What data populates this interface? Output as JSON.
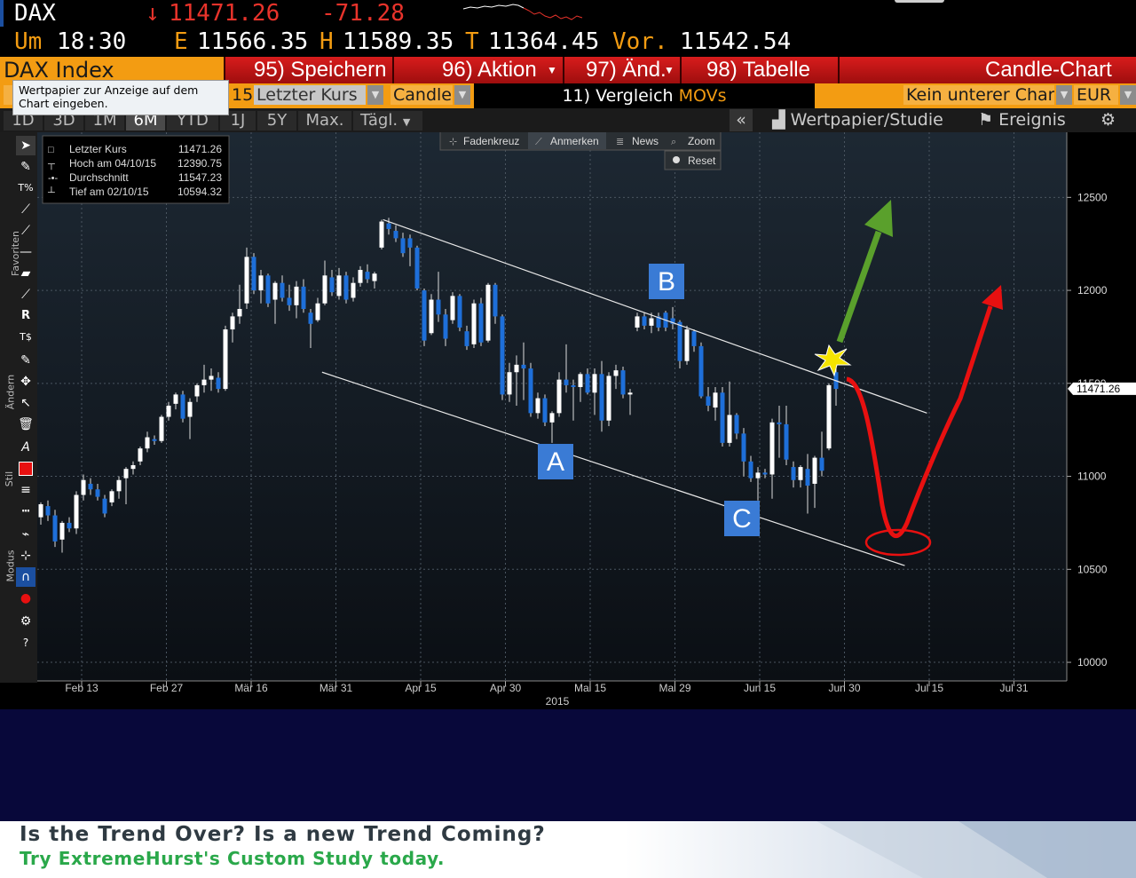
{
  "quote": {
    "ticker": "DAX",
    "arrow": "↓",
    "last": "11471.26",
    "change": "-71.28",
    "time_label": "Um",
    "time": "18:30",
    "open_label": "E",
    "open": "11566.35",
    "high_label": "H",
    "high": "11589.35",
    "low_label": "T",
    "low": "11364.45",
    "prev_label": "Vor.",
    "prev": "11542.54"
  },
  "toolbar": {
    "index_name": "DAX Index",
    "save": "95) Speichern",
    "action": "96) Aktion",
    "change": "97) Änd.",
    "table": "98) Tabelle",
    "chart_type_title": "Candle-Chart"
  },
  "tooltip": {
    "text": "Wertpapier zur Anzeige auf dem Chart eingeben."
  },
  "options": {
    "date_field": "15",
    "price_field": "Letzter Kurs",
    "style_field": "Candle",
    "compare": "11) Vergleich",
    "compare_movs": "MOVs",
    "lower_chart": "Kein unterer Chart",
    "currency": "EUR"
  },
  "periods": {
    "items": [
      "1D",
      "3D",
      "1M",
      "6M",
      "YTD",
      "1J",
      "5Y",
      "Max."
    ],
    "active": "6M",
    "interval": "Tägl."
  },
  "right_tools": {
    "collapse": "«",
    "security_study": "Wertpapier/Studie",
    "events": "Ereignis"
  },
  "chart_tools": {
    "crosshair": "Fadenkreuz",
    "annotate": "Anmerken",
    "news": "News",
    "zoom": "Zoom",
    "reset": "Reset"
  },
  "palette_labels": {
    "favorites": "Favoriten",
    "change": "Ändern",
    "style": "Stil",
    "mode": "Modus"
  },
  "legend": [
    {
      "label": "Letzter Kurs",
      "value": "11471.26"
    },
    {
      "label": "Hoch am 04/10/15",
      "value": "12390.75"
    },
    {
      "label": "Durchschnitt",
      "value": "11547.23"
    },
    {
      "label": "Tief am 02/10/15",
      "value": "10594.32"
    }
  ],
  "annotations": {
    "A": "A",
    "B": "B",
    "C": "C"
  },
  "ad": {
    "line1": "Is the Trend Over? Is a new Trend Coming?",
    "line2": "Try ExtremeHurst's Custom Study today."
  },
  "colors": {
    "up_candle": "#ffffff",
    "down_candle": "#1e6fd9",
    "arrow_green": "#5aa02c",
    "arrow_red": "#e81010",
    "label_box": "#3a7bd5",
    "toolbar_red": "#c21414",
    "accent_orange": "#f39c12"
  },
  "chart_data": {
    "type": "candlestick",
    "title": "",
    "xlabel": "2015",
    "ylabel": "",
    "ylim": [
      9900,
      12850
    ],
    "y_ticks": [
      10000,
      10500,
      11000,
      11500,
      12000,
      12500
    ],
    "x_ticks": [
      "Feb 13",
      "Feb 27",
      "Mär 16",
      "Mär 31",
      "Apr 15",
      "Apr 30",
      "Mai 15",
      "Mai 29",
      "Jun 15",
      "Jun 30",
      "Jul 15",
      "Jul 31"
    ],
    "last_price_label": "11471.26",
    "last_value": 11471.26,
    "grid": true,
    "candles": [
      {
        "o": 10780,
        "h": 10860,
        "l": 10740,
        "c": 10850
      },
      {
        "o": 10840,
        "h": 10870,
        "l": 10760,
        "c": 10790
      },
      {
        "o": 10790,
        "h": 10820,
        "l": 10620,
        "c": 10650
      },
      {
        "o": 10660,
        "h": 10760,
        "l": 10590,
        "c": 10750
      },
      {
        "o": 10750,
        "h": 10780,
        "l": 10700,
        "c": 10720
      },
      {
        "o": 10720,
        "h": 10920,
        "l": 10690,
        "c": 10900
      },
      {
        "o": 10900,
        "h": 11010,
        "l": 10870,
        "c": 10980
      },
      {
        "o": 10960,
        "h": 10990,
        "l": 10900,
        "c": 10930
      },
      {
        "o": 10930,
        "h": 10960,
        "l": 10870,
        "c": 10890
      },
      {
        "o": 10880,
        "h": 10900,
        "l": 10780,
        "c": 10800
      },
      {
        "o": 10860,
        "h": 10930,
        "l": 10840,
        "c": 10920
      },
      {
        "o": 10920,
        "h": 11000,
        "l": 10880,
        "c": 10980
      },
      {
        "o": 10990,
        "h": 11050,
        "l": 10850,
        "c": 11040
      },
      {
        "o": 11040,
        "h": 11080,
        "l": 11010,
        "c": 11060
      },
      {
        "o": 11080,
        "h": 11160,
        "l": 11060,
        "c": 11150
      },
      {
        "o": 11150,
        "h": 11240,
        "l": 11130,
        "c": 11210
      },
      {
        "o": 11200,
        "h": 11220,
        "l": 11170,
        "c": 11190
      },
      {
        "o": 11190,
        "h": 11330,
        "l": 11180,
        "c": 11320
      },
      {
        "o": 11320,
        "h": 11400,
        "l": 11300,
        "c": 11380
      },
      {
        "o": 11390,
        "h": 11450,
        "l": 11360,
        "c": 11440
      },
      {
        "o": 11440,
        "h": 11460,
        "l": 11290,
        "c": 11310
      },
      {
        "o": 11320,
        "h": 11420,
        "l": 11200,
        "c": 11400
      },
      {
        "o": 11430,
        "h": 11500,
        "l": 11400,
        "c": 11490
      },
      {
        "o": 11490,
        "h": 11600,
        "l": 11450,
        "c": 11520
      },
      {
        "o": 11520,
        "h": 11580,
        "l": 11460,
        "c": 11540
      },
      {
        "o": 11530,
        "h": 11560,
        "l": 11450,
        "c": 11470
      },
      {
        "o": 11470,
        "h": 11810,
        "l": 11460,
        "c": 11790
      },
      {
        "o": 11790,
        "h": 11880,
        "l": 11720,
        "c": 11860
      },
      {
        "o": 11860,
        "h": 12030,
        "l": 11820,
        "c": 11900
      },
      {
        "o": 11930,
        "h": 12230,
        "l": 11900,
        "c": 12180
      },
      {
        "o": 12180,
        "h": 12200,
        "l": 11980,
        "c": 12000
      },
      {
        "o": 12000,
        "h": 12110,
        "l": 11930,
        "c": 12080
      },
      {
        "o": 12080,
        "h": 12090,
        "l": 11910,
        "c": 11930
      },
      {
        "o": 11950,
        "h": 12050,
        "l": 11820,
        "c": 12040
      },
      {
        "o": 12040,
        "h": 12080,
        "l": 11940,
        "c": 11960
      },
      {
        "o": 11960,
        "h": 12030,
        "l": 11890,
        "c": 11920
      },
      {
        "o": 11920,
        "h": 12050,
        "l": 11850,
        "c": 12020
      },
      {
        "o": 12020,
        "h": 12060,
        "l": 11880,
        "c": 11900
      },
      {
        "o": 11880,
        "h": 11900,
        "l": 11690,
        "c": 11820
      },
      {
        "o": 11840,
        "h": 11960,
        "l": 11830,
        "c": 11930
      },
      {
        "o": 11930,
        "h": 12160,
        "l": 11920,
        "c": 12080
      },
      {
        "o": 12070,
        "h": 12110,
        "l": 11970,
        "c": 11990
      },
      {
        "o": 11970,
        "h": 12120,
        "l": 11950,
        "c": 12080
      },
      {
        "o": 12080,
        "h": 12100,
        "l": 11930,
        "c": 11950
      },
      {
        "o": 11960,
        "h": 12070,
        "l": 11940,
        "c": 12040
      },
      {
        "o": 12040,
        "h": 12130,
        "l": 12020,
        "c": 12110
      },
      {
        "o": 12100,
        "h": 12140,
        "l": 12040,
        "c": 12060
      },
      {
        "o": 12050,
        "h": 12100,
        "l": 12010,
        "c": 12090
      },
      {
        "o": 12230,
        "h": 12380,
        "l": 12220,
        "c": 12370
      },
      {
        "o": 12360,
        "h": 12390,
        "l": 12300,
        "c": 12330
      },
      {
        "o": 12320,
        "h": 12350,
        "l": 12260,
        "c": 12280
      },
      {
        "o": 12280,
        "h": 12310,
        "l": 12180,
        "c": 12200
      },
      {
        "o": 12280,
        "h": 12300,
        "l": 12130,
        "c": 12230
      },
      {
        "o": 12230,
        "h": 12240,
        "l": 12000,
        "c": 12010
      },
      {
        "o": 12000,
        "h": 12010,
        "l": 11700,
        "c": 11730
      },
      {
        "o": 11770,
        "h": 11980,
        "l": 11760,
        "c": 11950
      },
      {
        "o": 11950,
        "h": 12100,
        "l": 11830,
        "c": 11870
      },
      {
        "o": 11870,
        "h": 11900,
        "l": 11700,
        "c": 11740
      },
      {
        "o": 11840,
        "h": 11990,
        "l": 11820,
        "c": 11970
      },
      {
        "o": 11970,
        "h": 11980,
        "l": 11780,
        "c": 11800
      },
      {
        "o": 11780,
        "h": 11810,
        "l": 11680,
        "c": 11700
      },
      {
        "o": 11710,
        "h": 11950,
        "l": 11690,
        "c": 11930
      },
      {
        "o": 11930,
        "h": 11960,
        "l": 11700,
        "c": 11720
      },
      {
        "o": 11730,
        "h": 12040,
        "l": 11720,
        "c": 12030
      },
      {
        "o": 12030,
        "h": 12040,
        "l": 11820,
        "c": 11860
      },
      {
        "o": 11860,
        "h": 11870,
        "l": 11410,
        "c": 11440
      },
      {
        "o": 11440,
        "h": 11610,
        "l": 11400,
        "c": 11560
      },
      {
        "o": 11560,
        "h": 11650,
        "l": 11380,
        "c": 11600
      },
      {
        "o": 11600,
        "h": 11720,
        "l": 11410,
        "c": 11580
      },
      {
        "o": 11580,
        "h": 11610,
        "l": 11320,
        "c": 11340
      },
      {
        "o": 11340,
        "h": 11450,
        "l": 11310,
        "c": 11420
      },
      {
        "o": 11420,
        "h": 11440,
        "l": 11270,
        "c": 11290
      },
      {
        "o": 11290,
        "h": 11350,
        "l": 11180,
        "c": 11340
      },
      {
        "o": 11340,
        "h": 11560,
        "l": 11320,
        "c": 11520
      },
      {
        "o": 11520,
        "h": 11710,
        "l": 11450,
        "c": 11490
      },
      {
        "o": 11490,
        "h": 11520,
        "l": 11300,
        "c": 11480
      },
      {
        "o": 11480,
        "h": 11560,
        "l": 11400,
        "c": 11550
      },
      {
        "o": 11550,
        "h": 11580,
        "l": 11440,
        "c": 11450
      },
      {
        "o": 11450,
        "h": 11580,
        "l": 11330,
        "c": 11550
      },
      {
        "o": 11550,
        "h": 11620,
        "l": 11240,
        "c": 11300
      },
      {
        "o": 11300,
        "h": 11560,
        "l": 11270,
        "c": 11540
      },
      {
        "o": 11540,
        "h": 11600,
        "l": 11470,
        "c": 11570
      },
      {
        "o": 11570,
        "h": 11590,
        "l": 11420,
        "c": 11440
      },
      {
        "o": 11440,
        "h": 11470,
        "l": 11330,
        "c": 11450
      },
      {
        "o": 11800,
        "h": 11880,
        "l": 11780,
        "c": 11860
      },
      {
        "o": 11860,
        "h": 11880,
        "l": 11790,
        "c": 11810
      },
      {
        "o": 11810,
        "h": 11880,
        "l": 11770,
        "c": 11850
      },
      {
        "o": 11860,
        "h": 11880,
        "l": 11780,
        "c": 11800
      },
      {
        "o": 11880,
        "h": 11890,
        "l": 11780,
        "c": 11800
      },
      {
        "o": 11850,
        "h": 11910,
        "l": 11790,
        "c": 11820
      },
      {
        "o": 11830,
        "h": 11840,
        "l": 11580,
        "c": 11620
      },
      {
        "o": 11620,
        "h": 11810,
        "l": 11600,
        "c": 11790
      },
      {
        "o": 11780,
        "h": 11790,
        "l": 11670,
        "c": 11700
      },
      {
        "o": 11700,
        "h": 11720,
        "l": 11420,
        "c": 11430
      },
      {
        "o": 11430,
        "h": 11480,
        "l": 11350,
        "c": 11380
      },
      {
        "o": 11370,
        "h": 11480,
        "l": 11300,
        "c": 11450
      },
      {
        "o": 11450,
        "h": 11480,
        "l": 11160,
        "c": 11180
      },
      {
        "o": 11180,
        "h": 11510,
        "l": 11160,
        "c": 11330
      },
      {
        "o": 11330,
        "h": 11340,
        "l": 11200,
        "c": 11230
      },
      {
        "o": 11230,
        "h": 11260,
        "l": 11000,
        "c": 11080
      },
      {
        "o": 11080,
        "h": 11110,
        "l": 10970,
        "c": 10990
      },
      {
        "o": 10990,
        "h": 11050,
        "l": 10870,
        "c": 11020
      },
      {
        "o": 11020,
        "h": 11040,
        "l": 10990,
        "c": 11010
      },
      {
        "o": 11010,
        "h": 11310,
        "l": 10880,
        "c": 11290
      },
      {
        "o": 11290,
        "h": 11380,
        "l": 11100,
        "c": 11280
      },
      {
        "o": 11280,
        "h": 11380,
        "l": 11060,
        "c": 11090
      },
      {
        "o": 11050,
        "h": 11080,
        "l": 10940,
        "c": 10980
      },
      {
        "o": 10980,
        "h": 11060,
        "l": 10940,
        "c": 11050
      },
      {
        "o": 11040,
        "h": 11120,
        "l": 10800,
        "c": 10950
      },
      {
        "o": 10960,
        "h": 11110,
        "l": 10830,
        "c": 11100
      },
      {
        "o": 11100,
        "h": 11240,
        "l": 11000,
        "c": 11030
      },
      {
        "o": 11150,
        "h": 11500,
        "l": 11140,
        "c": 11490
      },
      {
        "o": 11560,
        "h": 11580,
        "l": 11380,
        "c": 11470
      }
    ],
    "channel_upper": [
      {
        "x": "Apr 08",
        "y": 12380
      },
      {
        "x": "Jul 15",
        "y": 11340
      }
    ],
    "channel_lower": [
      {
        "x": "Mär 28",
        "y": 11560
      },
      {
        "x": "Jul 11",
        "y": 10520
      }
    ],
    "channel_labels": [
      "A",
      "B",
      "C"
    ]
  }
}
